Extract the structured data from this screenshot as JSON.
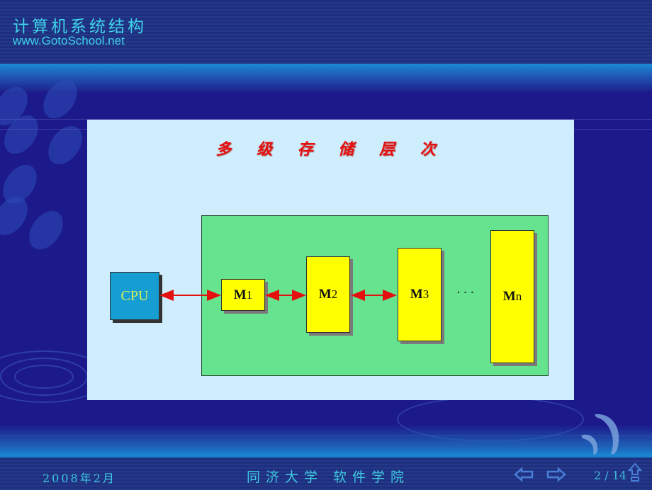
{
  "header": {
    "title": "计算机系统结构",
    "url": "www.GotoSchool.net"
  },
  "slide": {
    "title": "多 级 存 储 层 次",
    "diagram": {
      "cpu_label": "CPU",
      "memory_levels": [
        {
          "name": "M",
          "sub": "1"
        },
        {
          "name": "M",
          "sub": "2"
        },
        {
          "name": "M",
          "sub": "3"
        },
        {
          "name": "M",
          "sub": "n"
        }
      ],
      "ellipsis": "···",
      "colors": {
        "panel": "#cfeefd",
        "memory_group": "#66e38f",
        "memory_box": "#ffff00",
        "cpu_box": "#169ed3",
        "arrows": "#e41010",
        "title": "#e41010"
      }
    }
  },
  "footer": {
    "date": "2008年2月",
    "school": "同济大学 软件学院",
    "page_current": "2",
    "page_total": "14",
    "page_text": "2 / 14",
    "prev_icon": "left-arrow-icon",
    "next_icon": "right-arrow-icon",
    "home_icon": "up-arrow-icon"
  }
}
